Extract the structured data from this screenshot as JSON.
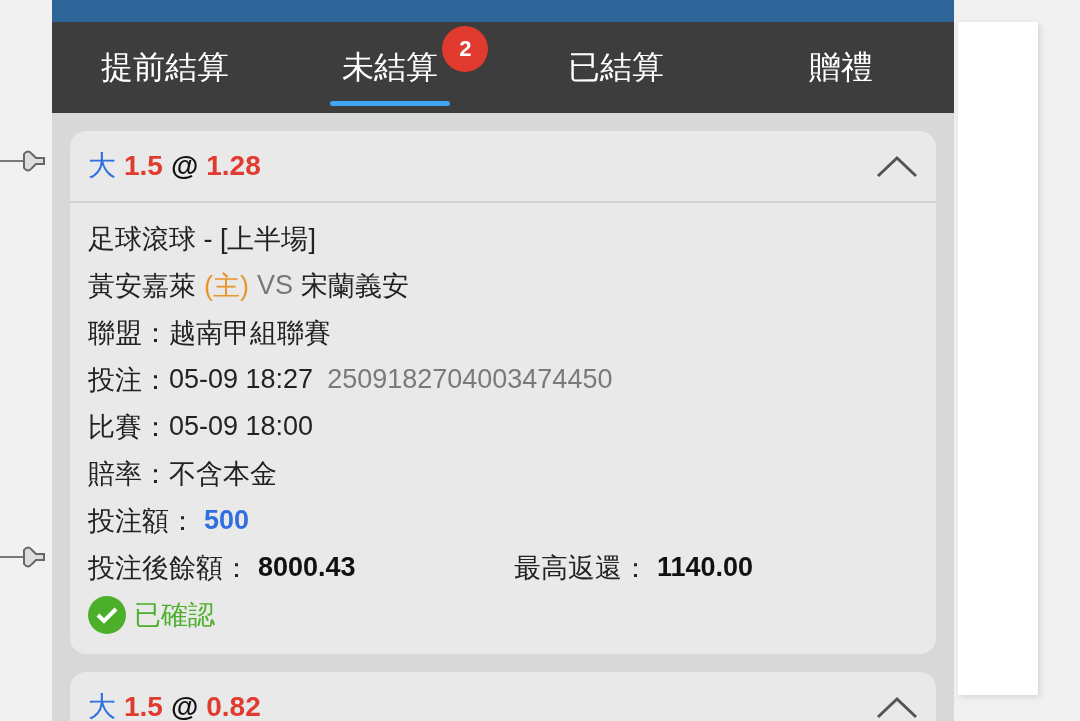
{
  "tabs": [
    {
      "label": "提前結算",
      "selected": false
    },
    {
      "label": "未結算",
      "selected": true,
      "badge": "2"
    },
    {
      "label": "已結算",
      "selected": false
    },
    {
      "label": "贈禮",
      "selected": false
    }
  ],
  "bets": [
    {
      "pick": "大",
      "line": "1.5",
      "at": "@",
      "odds": "1.28",
      "expanded": true,
      "market": "足球滾球 - [上半場]",
      "match": {
        "home": "黃安嘉萊",
        "home_tag": "(主)",
        "vs": "VS",
        "away": "宋蘭義安"
      },
      "rows": [
        {
          "kind": "plain",
          "label": "聯盟：",
          "value": "越南甲組聯賽"
        },
        {
          "kind": "ref",
          "label": "投注：",
          "value": "05-09 18:27",
          "extra": "2509182704003474450"
        },
        {
          "kind": "plain",
          "label": "比賽：",
          "value": "05-09 18:00"
        },
        {
          "kind": "plain",
          "label": "賠率：",
          "value": "不含本金"
        },
        {
          "kind": "stake",
          "label": "投注額：",
          "value": "500"
        },
        {
          "kind": "pair",
          "label": "投注後餘額：",
          "value": "8000.43",
          "label2": "最高返還：",
          "value2": "1140.00"
        }
      ],
      "status": {
        "label": "已確認",
        "confirmed": true
      }
    },
    {
      "pick": "大",
      "line": "1.5",
      "at": "@",
      "odds": "0.82",
      "expanded": true
    }
  ]
}
